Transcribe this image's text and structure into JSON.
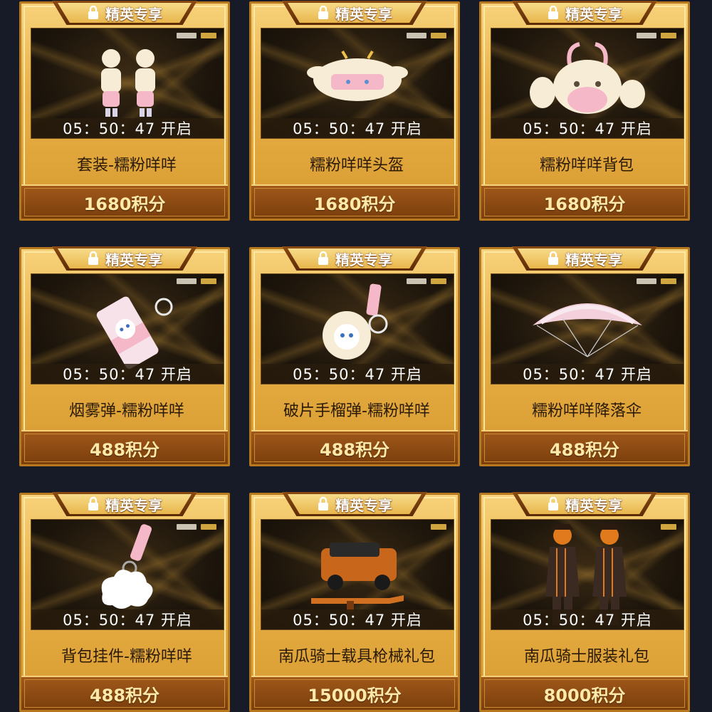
{
  "cards": [
    {
      "badge": "精英专享",
      "timer": "05：50：47 开启",
      "name": "套装-糯粉咩咩",
      "price": "1680积分",
      "art": "outfit-pair-icon"
    },
    {
      "badge": "精英专享",
      "timer": "05：50：47 开启",
      "name": "糯粉咩咩头盔",
      "price": "1680积分",
      "art": "helmet-icon"
    },
    {
      "badge": "精英专享",
      "timer": "05：50：47 开启",
      "name": "糯粉咩咩背包",
      "price": "1680积分",
      "art": "backpack-icon"
    },
    {
      "badge": "精英专享",
      "timer": "05：50：47 开启",
      "name": "烟雾弹-糯粉咩咩",
      "price": "488积分",
      "art": "smoke-grenade-icon"
    },
    {
      "badge": "精英专享",
      "timer": "05：50：47 开启",
      "name": "破片手榴弹-糯粉咩咩",
      "price": "488积分",
      "art": "frag-grenade-icon"
    },
    {
      "badge": "精英专享",
      "timer": "05：50：47 开启",
      "name": "糯粉咩咩降落伞",
      "price": "488积分",
      "art": "parachute-icon"
    },
    {
      "badge": "精英专享",
      "timer": "05：50：47 开启",
      "name": "背包挂件-糯粉咩咩",
      "price": "488积分",
      "art": "backpack-charm-icon"
    },
    {
      "badge": "精英专享",
      "timer": "05：50：47 开启",
      "name": "南瓜骑士载具枪械礼包",
      "price": "15000积分",
      "art": "vehicle-gun-icon"
    },
    {
      "badge": "精英专享",
      "timer": "05：50：47 开启",
      "name": "南瓜骑士服装礼包",
      "price": "8000积分",
      "art": "pumpkin-knight-icon"
    }
  ],
  "colors": {
    "background": "#171a27",
    "card_gold": "#e9b24a",
    "price_bar": "#7a3e0c",
    "price_text": "#ffe9a8"
  }
}
